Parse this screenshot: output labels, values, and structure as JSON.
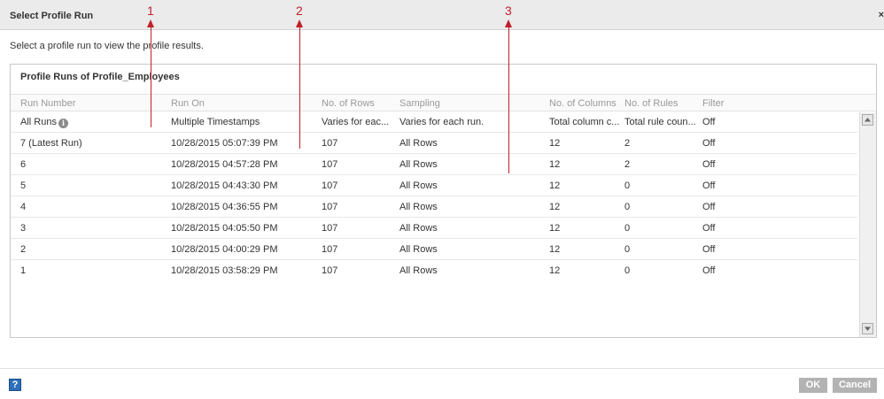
{
  "dialog": {
    "title": "Select Profile Run",
    "close_icon": "×",
    "instruction": "Select a profile run to view the profile results.",
    "panel_title": "Profile Runs of Profile_Employees"
  },
  "table": {
    "columns": [
      "Run Number",
      "Run On",
      "No. of Rows",
      "Sampling",
      "No. of Columns",
      "No. of Rules",
      "Filter"
    ],
    "info_icon": "info-circle-icon",
    "rows": [
      {
        "run": "All Runs",
        "run_on": "Multiple Timestamps",
        "rows": "Varies for eac...",
        "sampling": "Varies for each run.",
        "cols": "Total column c...",
        "rules": "Total rule coun...",
        "filter": "Off"
      },
      {
        "run": "7 (Latest Run)",
        "run_on": "10/28/2015 05:07:39 PM",
        "rows": "107",
        "sampling": "All Rows",
        "cols": "12",
        "rules": "2",
        "filter": "Off"
      },
      {
        "run": "6",
        "run_on": "10/28/2015 04:57:28 PM",
        "rows": "107",
        "sampling": "All Rows",
        "cols": "12",
        "rules": "2",
        "filter": "Off"
      },
      {
        "run": "5",
        "run_on": "10/28/2015 04:43:30 PM",
        "rows": "107",
        "sampling": "All Rows",
        "cols": "12",
        "rules": "0",
        "filter": "Off"
      },
      {
        "run": "4",
        "run_on": "10/28/2015 04:36:55 PM",
        "rows": "107",
        "sampling": "All Rows",
        "cols": "12",
        "rules": "0",
        "filter": "Off"
      },
      {
        "run": "3",
        "run_on": "10/28/2015 04:05:50 PM",
        "rows": "107",
        "sampling": "All Rows",
        "cols": "12",
        "rules": "0",
        "filter": "Off"
      },
      {
        "run": "2",
        "run_on": "10/28/2015 04:00:29 PM",
        "rows": "107",
        "sampling": "All Rows",
        "cols": "12",
        "rules": "0",
        "filter": "Off"
      },
      {
        "run": "1",
        "run_on": "10/28/2015 03:58:29 PM",
        "rows": "107",
        "sampling": "All Rows",
        "cols": "12",
        "rules": "0",
        "filter": "Off"
      }
    ]
  },
  "annotations": [
    "1",
    "2",
    "3"
  ],
  "annotation_color": "#c0202a",
  "footer": {
    "help_label": "?",
    "ok_label": "OK",
    "cancel_label": "Cancel"
  }
}
